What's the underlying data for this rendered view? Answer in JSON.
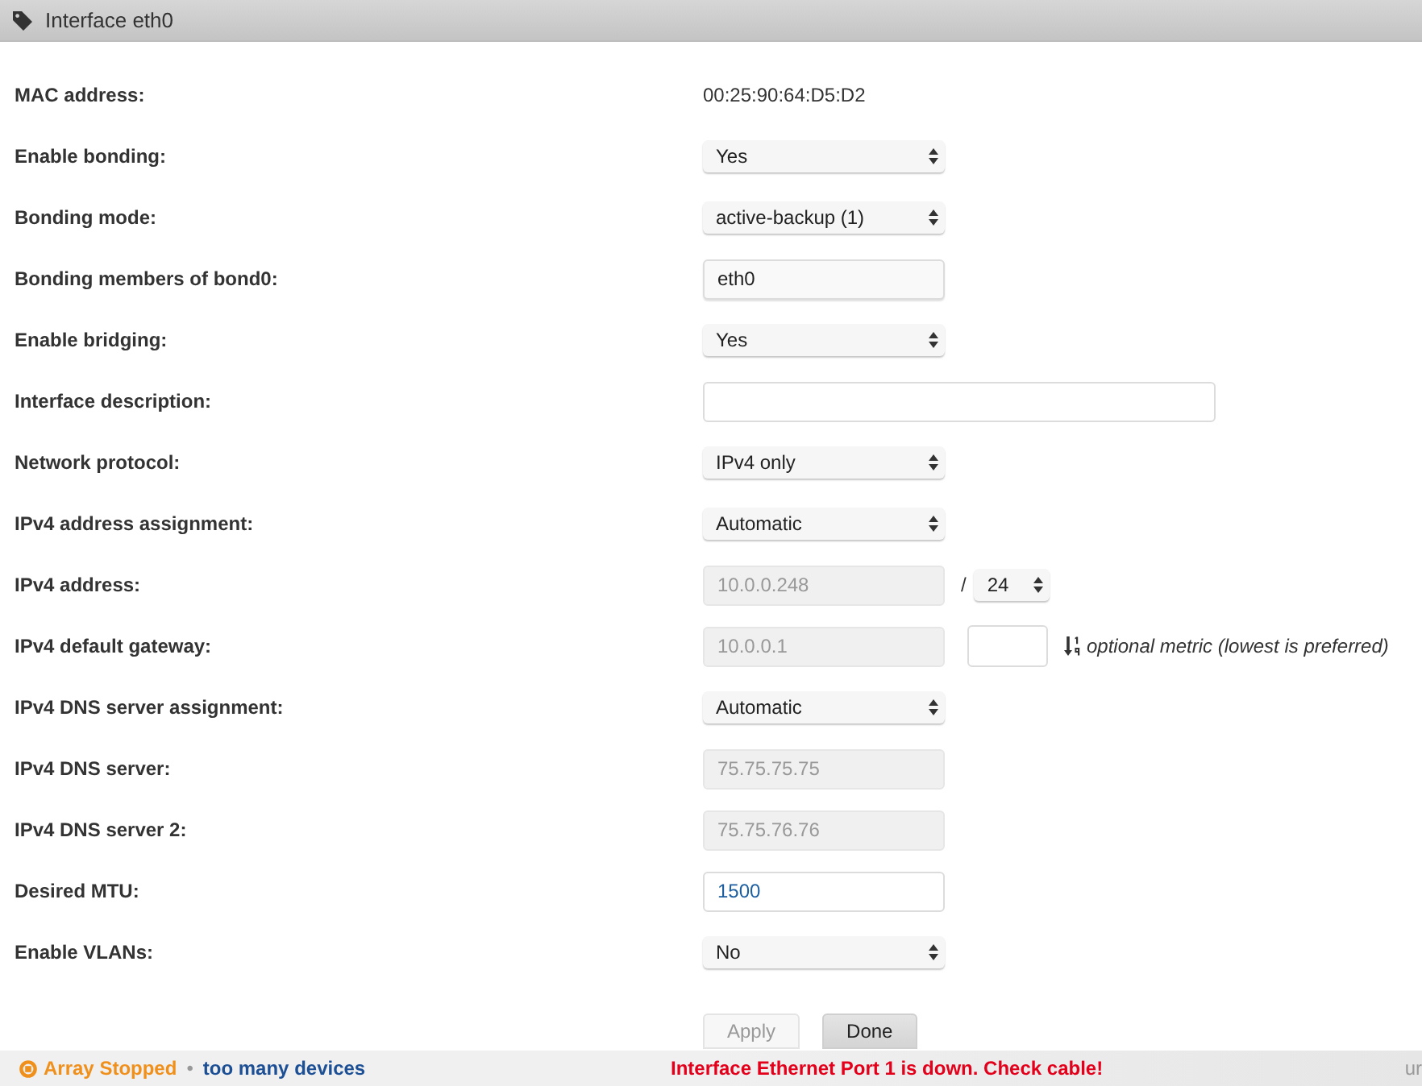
{
  "header": {
    "title": "Interface eth0"
  },
  "fields": [
    {
      "label": "MAC address:",
      "kind": "text",
      "value": "00:25:90:64:D5:D2"
    },
    {
      "label": "Enable bonding:",
      "kind": "select",
      "value": "Yes",
      "disabled": false
    },
    {
      "label": "Bonding mode:",
      "kind": "select",
      "value": "active-backup (1)",
      "disabled": false
    },
    {
      "label": "Bonding members of bond0:",
      "kind": "multiselect",
      "value": "eth0",
      "disabled": false
    },
    {
      "label": "Enable bridging:",
      "kind": "select",
      "value": "Yes",
      "disabled": false
    },
    {
      "label": "Interface description:",
      "kind": "longinput",
      "disabled": false
    },
    {
      "label": "Network protocol:",
      "kind": "select",
      "value": "IPv4 only",
      "disabled": false
    },
    {
      "label": "IPv4 address assignment:",
      "kind": "select",
      "value": "Automatic",
      "disabled": false
    },
    {
      "label": "IPv4 address:",
      "kind": "address",
      "value": "10.0.0.248",
      "disabled": true,
      "separator": "/",
      "prefix": "24"
    },
    {
      "label": "IPv4 default gateway:",
      "kind": "gateway",
      "value": "10.0.0.1",
      "disabled": true,
      "note": "optional metric (lowest is preferred)"
    },
    {
      "label": "IPv4 DNS server assignment:",
      "kind": "select",
      "value": "Automatic",
      "disabled": false
    },
    {
      "label": "IPv4 DNS server:",
      "kind": "input",
      "value": "75.75.75.75",
      "disabled": true
    },
    {
      "label": "IPv4 DNS server 2:",
      "kind": "input",
      "value": "75.75.76.76",
      "disabled": true
    },
    {
      "label": "Desired MTU:",
      "kind": "input",
      "value": "1500",
      "disabled": false
    },
    {
      "label": "Enable VLANs:",
      "kind": "select",
      "value": "No",
      "disabled": false
    }
  ],
  "buttons": [
    {
      "label": "Apply",
      "disabled": true
    },
    {
      "label": "Done",
      "disabled": false
    }
  ],
  "status_bar": {
    "array_status": "Array Stopped",
    "separator": "•",
    "device_note": "too many devices",
    "message": "Interface Ethernet Port 1 is down. Check cable!",
    "right_text": "ur"
  }
}
